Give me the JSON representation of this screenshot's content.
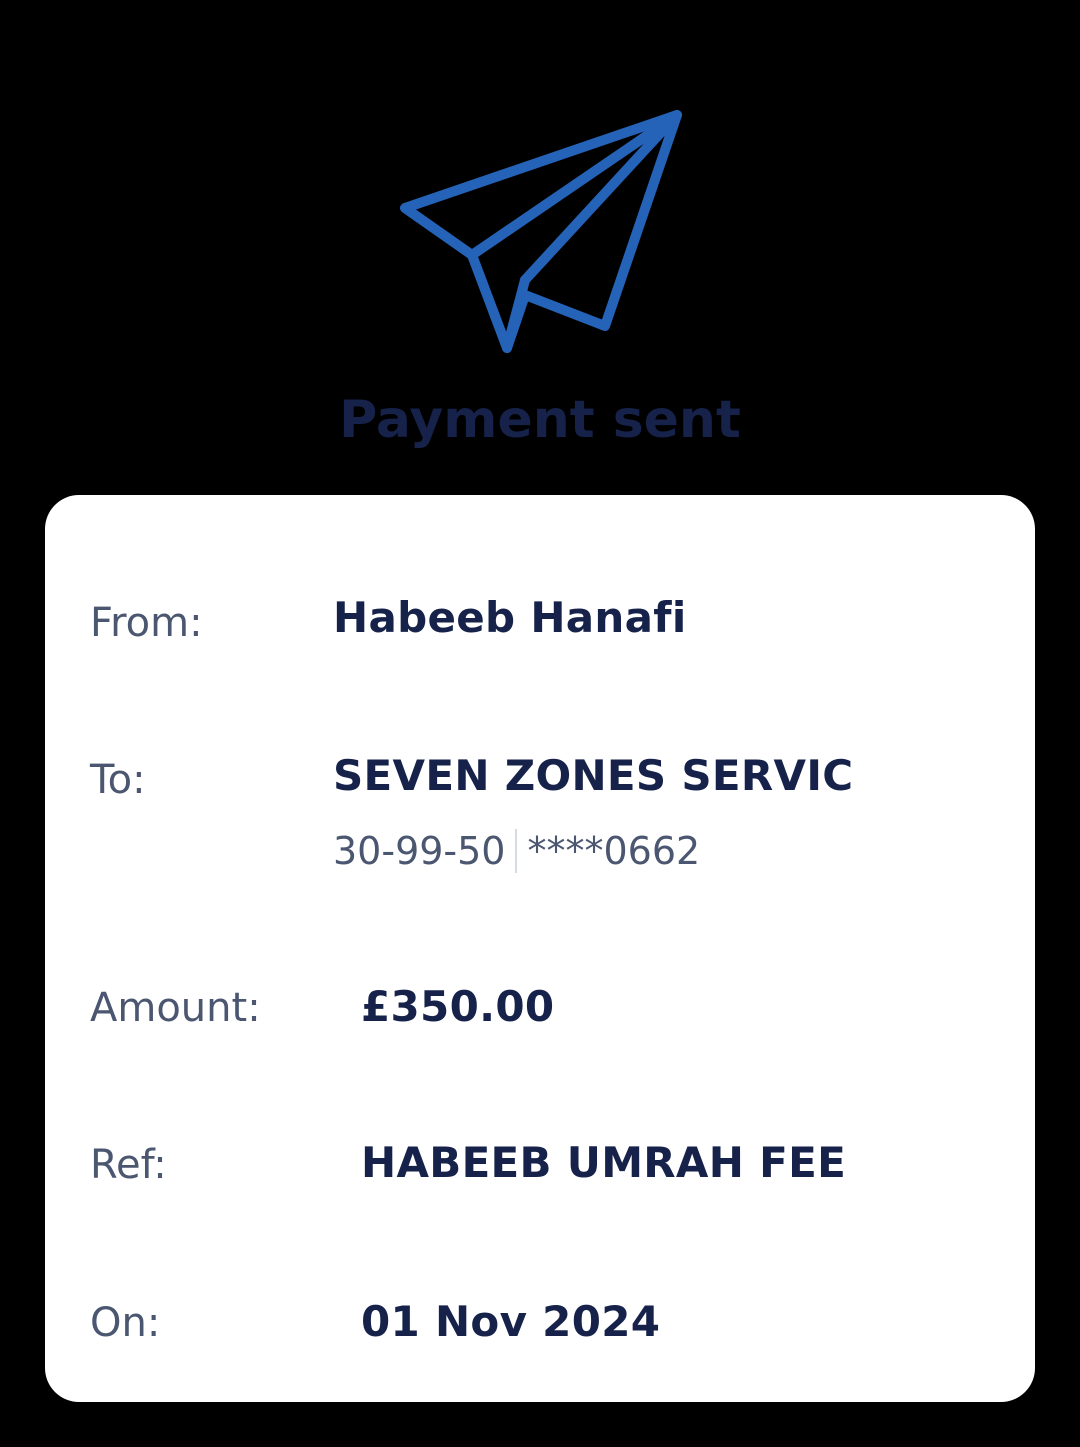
{
  "page": {
    "title": "Payment sent",
    "icon": "paper-plane-icon",
    "accent_color": "#2563b8"
  },
  "details": {
    "from_label": "From:",
    "from_value": "Habeeb Hanafi",
    "to_label": "To:",
    "to_value": "SEVEN ZONES SERVIC",
    "sort_code": "30-99-50",
    "account_masked": "****0662",
    "amount_label": "Amount:",
    "amount_value": "£350.00",
    "ref_label": "Ref:",
    "ref_value": "HABEEB UMRAH FEE",
    "on_label": "On:",
    "on_value": "01 Nov 2024"
  }
}
